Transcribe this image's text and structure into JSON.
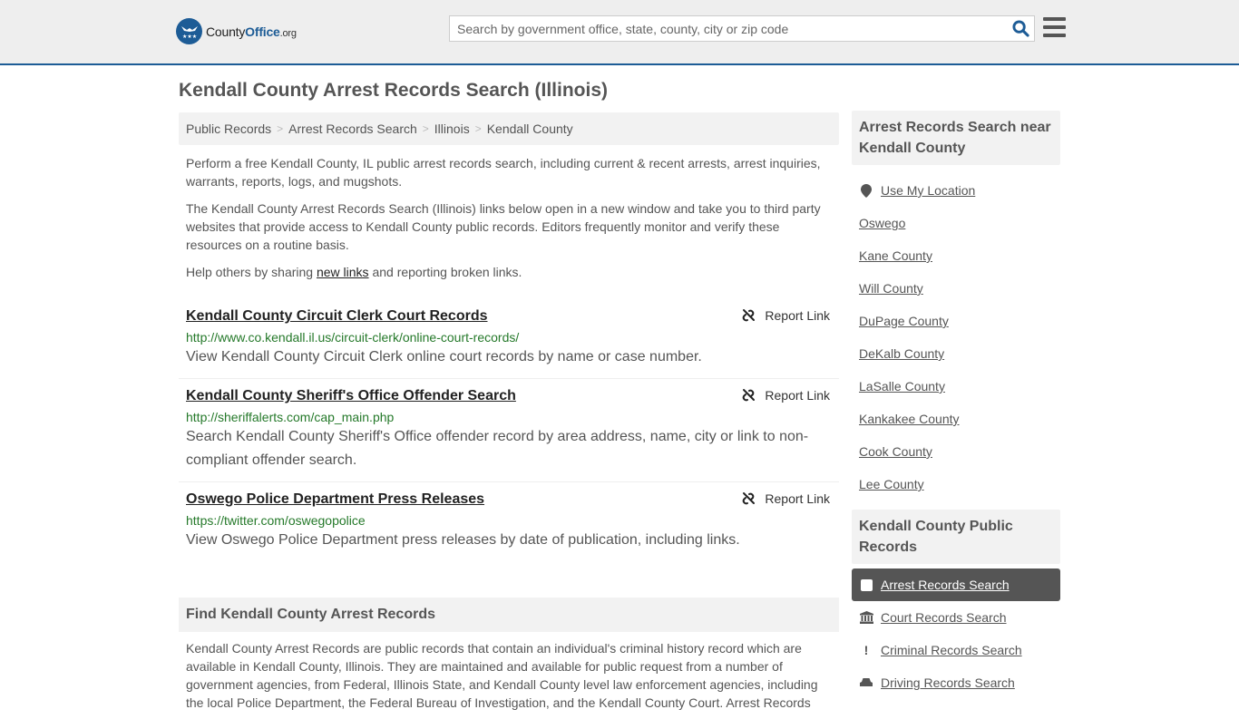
{
  "header": {
    "logo": {
      "county": "County",
      "office": "Office",
      "org": ".org"
    },
    "search_placeholder": "Search by government office, state, county, city or zip code"
  },
  "page_title": "Kendall County Arrest Records Search (Illinois)",
  "breadcrumb": [
    "Public Records",
    "Arrest Records Search",
    "Illinois",
    "Kendall County"
  ],
  "intro": {
    "p1": "Perform a free Kendall County, IL public arrest records search, including current & recent arrests, arrest inquiries, warrants, reports, logs, and mugshots.",
    "p2": "The Kendall County Arrest Records Search (Illinois) links below open in a new window and take you to third party websites that provide access to Kendall County public records. Editors frequently monitor and verify these resources on a routine basis.",
    "p3_before": "Help others by sharing ",
    "p3_link": "new links",
    "p3_after": " and reporting broken links."
  },
  "links": [
    {
      "title": "Kendall County Circuit Clerk Court Records",
      "url": "http://www.co.kendall.il.us/circuit-clerk/online-court-records/",
      "desc": "View Kendall County Circuit Clerk online court records by name or case number.",
      "report": "Report Link"
    },
    {
      "title": "Kendall County Sheriff's Office Offender Search",
      "url": "http://sheriffalerts.com/cap_main.php",
      "desc": "Search Kendall County Sheriff's Office offender record by area address, name, city or link to non-compliant offender search.",
      "report": "Report Link"
    },
    {
      "title": "Oswego Police Department Press Releases",
      "url": "https://twitter.com/oswegopolice",
      "desc": "View Oswego Police Department press releases by date of publication, including links.",
      "report": "Report Link"
    }
  ],
  "find": {
    "heading": "Find Kendall County Arrest Records",
    "text": "Kendall County Arrest Records are public records that contain an individual's criminal history record which are available in Kendall County, Illinois. They are maintained and available for public request from a number of government agencies, from Federal, Illinois State, and Kendall County level law enforcement agencies, including the local Police Department, the Federal Bureau of Investigation, and the Kendall County Court. Arrest Records"
  },
  "sidebar": {
    "nearby_heading": "Arrest Records Search near Kendall County",
    "use_location": "Use My Location",
    "nearby": [
      "Oswego",
      "Kane County",
      "Will County",
      "DuPage County",
      "DeKalb County",
      "LaSalle County",
      "Kankakee County",
      "Cook County",
      "Lee County"
    ],
    "public_heading": "Kendall County Public Records",
    "public_items": [
      {
        "label": "Arrest Records Search",
        "icon": "square-icon",
        "active": true
      },
      {
        "label": "Court Records Search",
        "icon": "courthouse-icon",
        "active": false
      },
      {
        "label": "Criminal Records Search",
        "icon": "exclamation-icon",
        "active": false
      },
      {
        "label": "Driving Records Search",
        "icon": "car-icon",
        "active": false
      }
    ]
  },
  "colors": {
    "brand": "#1d5c96",
    "url_green": "#25792a",
    "active_bg": "#555555"
  }
}
